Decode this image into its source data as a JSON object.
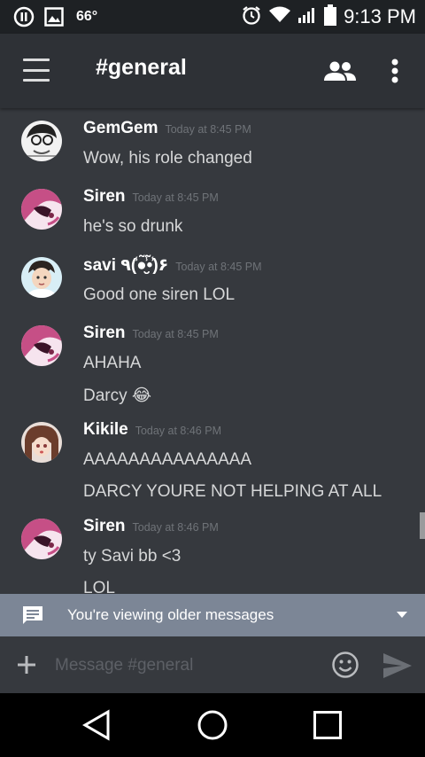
{
  "status_bar": {
    "temperature": "66°",
    "time": "9:13 PM",
    "icons": [
      "pause-circle-icon",
      "image-icon",
      "alarm-icon",
      "wifi-icon",
      "signal-icon",
      "battery-icon"
    ]
  },
  "header": {
    "channel_title": "#general",
    "icons": [
      "menu-icon",
      "members-icon",
      "more-vert-icon"
    ]
  },
  "messages": [
    {
      "author": "GemGem",
      "timestamp": "Today at 8:45 PM",
      "lines": [
        "Wow, his role changed"
      ],
      "avatar": "manga-avatar"
    },
    {
      "author": "Siren",
      "timestamp": "Today at 8:45 PM",
      "lines": [
        "he's so drunk"
      ],
      "avatar": "pink-hair-avatar"
    },
    {
      "author": "savi ٩(̾●̮̮̃̾•̃̾)۶",
      "timestamp": "Today at 8:45 PM",
      "lines": [
        "Good one siren LOL"
      ],
      "avatar": "anime-boy-avatar"
    },
    {
      "author": "Siren",
      "timestamp": "Today at 8:45 PM",
      "lines": [
        "AHAHA",
        "Darcy 😂"
      ],
      "avatar": "pink-hair-avatar"
    },
    {
      "author": "Kikile",
      "timestamp": "Today at 8:46 PM",
      "lines": [
        "AAAAAAAAAAAAAAA",
        "DARCY YOURE NOT HELPING AT ALL"
      ],
      "avatar": "brown-hair-avatar"
    },
    {
      "author": "Siren",
      "timestamp": "Today at 8:46 PM",
      "lines": [
        "ty Savi bb <3",
        "LOL"
      ],
      "avatar": "pink-hair-avatar"
    }
  ],
  "older_banner": {
    "text": "You're viewing older messages"
  },
  "composer": {
    "placeholder": "Message #general"
  },
  "colors": {
    "background": "#36393e",
    "header": "#2e3136",
    "status_bar": "#1e2124",
    "banner": "#7c8696",
    "timestamp": "#6f7378"
  }
}
